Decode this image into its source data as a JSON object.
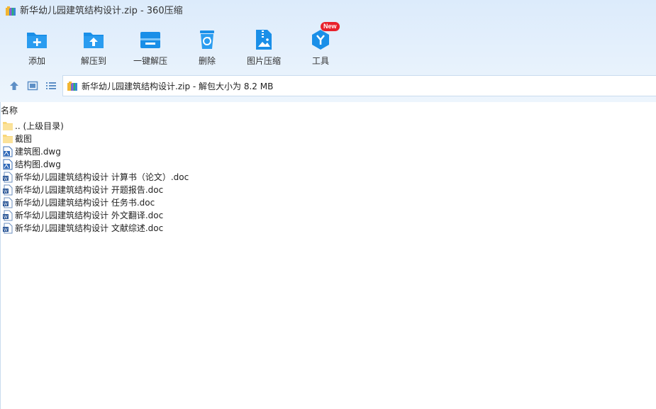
{
  "window": {
    "title": "新华幼儿园建筑结构设计.zip - 360压缩"
  },
  "toolbar": {
    "buttons": [
      {
        "label": "添加",
        "icon": "add-folder-icon"
      },
      {
        "label": "解压到",
        "icon": "extract-to-icon"
      },
      {
        "label": "一键解压",
        "icon": "one-click-extract-icon"
      },
      {
        "label": "删除",
        "icon": "recycle-bin-icon"
      },
      {
        "label": "图片压缩",
        "icon": "image-compress-icon"
      },
      {
        "label": "工具",
        "icon": "tools-icon",
        "badge": "New"
      }
    ]
  },
  "address": {
    "text": "新华幼儿园建筑结构设计.zip - 解包大小为 8.2 MB"
  },
  "list": {
    "column_name": "名称",
    "items": [
      {
        "name": ".. (上级目录)",
        "type": "folder"
      },
      {
        "name": "截图",
        "type": "folder"
      },
      {
        "name": "建筑图.dwg",
        "type": "dwg"
      },
      {
        "name": "结构图.dwg",
        "type": "dwg"
      },
      {
        "name": "新华幼儿园建筑结构设计 计算书（论文）.doc",
        "type": "doc"
      },
      {
        "name": "新华幼儿园建筑结构设计 开题报告.doc",
        "type": "doc"
      },
      {
        "name": "新华幼儿园建筑结构设计 任务书.doc",
        "type": "doc"
      },
      {
        "name": "新华幼儿园建筑结构设计 外文翻译.doc",
        "type": "doc"
      },
      {
        "name": "新华幼儿园建筑结构设计 文献综述.doc",
        "type": "doc"
      }
    ]
  },
  "colors": {
    "accent": "#1a8fe8",
    "toolbar_bg": "#e3effb",
    "folder": "#f8d77a",
    "badge": "#e8212b"
  }
}
